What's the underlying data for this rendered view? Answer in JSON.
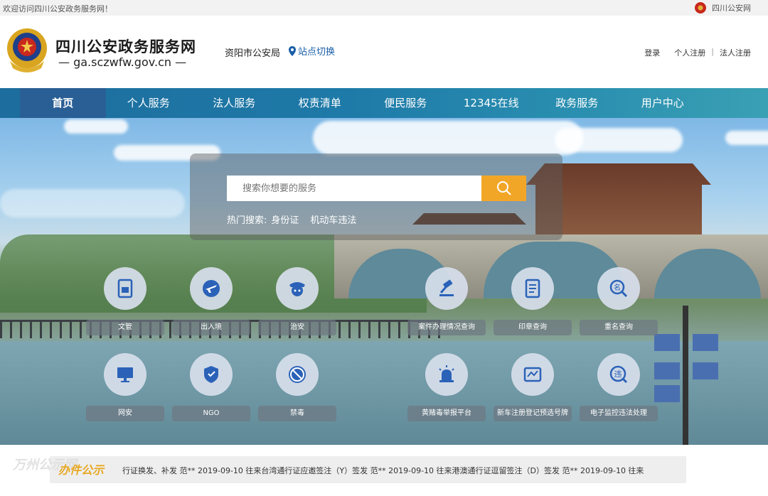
{
  "topbar": {
    "welcome": "欢迎访问四川公安政务服务网！",
    "site_name": "四川公安网"
  },
  "header": {
    "title": "四川公安政务服务网",
    "url": "— ga.sczwfw.gov.cn —",
    "bureau": "资阳市公安局",
    "site_switch": "站点切换",
    "login": "登录",
    "personal_register": "个人注册",
    "sep": "|",
    "legal_register": "法人注册"
  },
  "nav": [
    "首页",
    "个人服务",
    "法人服务",
    "权责清单",
    "便民服务",
    "12345在线",
    "政务服务",
    "用户中心"
  ],
  "search": {
    "placeholder": "搜索你想要的服务",
    "hot_label": "热门搜索:",
    "hot_keywords": [
      "身份证",
      "机动车违法"
    ]
  },
  "services_row1": [
    {
      "label": "文管",
      "icon": "id-card-icon"
    },
    {
      "label": "出入境",
      "icon": "airplane-icon"
    },
    {
      "label": "治安",
      "icon": "police-officer-icon"
    },
    {
      "label": "案件办理情况查询",
      "icon": "gavel-icon"
    },
    {
      "label": "印章查询",
      "icon": "document-seal-icon"
    },
    {
      "label": "重名查询",
      "icon": "name-search-icon"
    }
  ],
  "services_row2": [
    {
      "label": "网安",
      "icon": "monitor-icon"
    },
    {
      "label": "NGO",
      "icon": "shield-icon"
    },
    {
      "label": "禁毒",
      "icon": "no-drugs-icon"
    },
    {
      "label": "黄赌毒举报平台",
      "icon": "alarm-light-icon"
    },
    {
      "label": "新车注册登记预选号牌",
      "icon": "license-plate-icon"
    },
    {
      "label": "电子监控违法处理",
      "icon": "traffic-violation-icon"
    }
  ],
  "notice": {
    "badge": "办件公示",
    "watermark": "万州公示网",
    "text": "行证换发、补发  范**  2019-09-10      往来台湾通行证应邀签注（Y）签发  范**  2019-09-10      往来港澳通行证逗留签注（D）签发  范**  2019-09-10      往来"
  },
  "colors": {
    "nav_active": "#2a5f95",
    "search_button": "#f2a628",
    "accent_blue": "#1a5fa8"
  }
}
